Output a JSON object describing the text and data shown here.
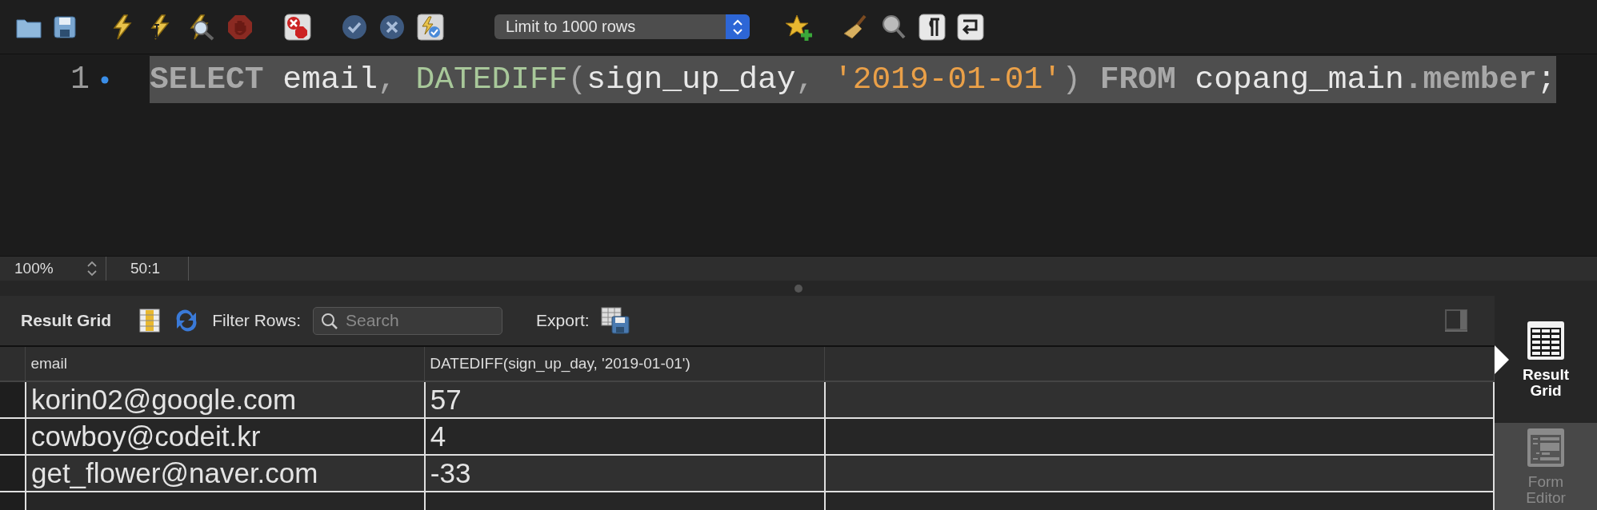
{
  "toolbar": {
    "limit_select": {
      "value": "Limit to 1000 rows"
    }
  },
  "editor": {
    "lines": [
      {
        "number": "1",
        "code": [
          {
            "kind": "keyword",
            "text": "SELECT"
          },
          {
            "kind": "ident",
            "text": " email"
          },
          {
            "kind": "punct",
            "text": ", "
          },
          {
            "kind": "func",
            "text": "DATEDIFF"
          },
          {
            "kind": "punct",
            "text": "("
          },
          {
            "kind": "ident",
            "text": "sign_up_day"
          },
          {
            "kind": "punct",
            "text": ", "
          },
          {
            "kind": "string",
            "text": "'2019-01-01'"
          },
          {
            "kind": "punct",
            "text": ") "
          },
          {
            "kind": "keyword",
            "text": "FROM"
          },
          {
            "kind": "ident",
            "text": " copang_main"
          },
          {
            "kind": "keyword",
            "text": ".member"
          },
          {
            "kind": "ident",
            "text": ";"
          }
        ]
      }
    ]
  },
  "status_bar": {
    "zoom": "100%",
    "position": "50:1"
  },
  "results": {
    "title": "Result Grid",
    "filter_label": "Filter Rows:",
    "search": {
      "placeholder": "Search"
    },
    "export_label": "Export:"
  },
  "table": {
    "columns": [
      "email",
      "DATEDIFF(sign_up_day, '2019-01-01')"
    ],
    "rows": [
      [
        "korin02@google.com",
        "57"
      ],
      [
        "cowboy@codeit.kr",
        "4"
      ],
      [
        "get_flower@naver.com",
        "-33"
      ]
    ]
  },
  "side_panel": {
    "items": [
      {
        "label": "Result Grid",
        "selected": true
      },
      {
        "label": "Form Editor",
        "selected": false
      }
    ]
  }
}
